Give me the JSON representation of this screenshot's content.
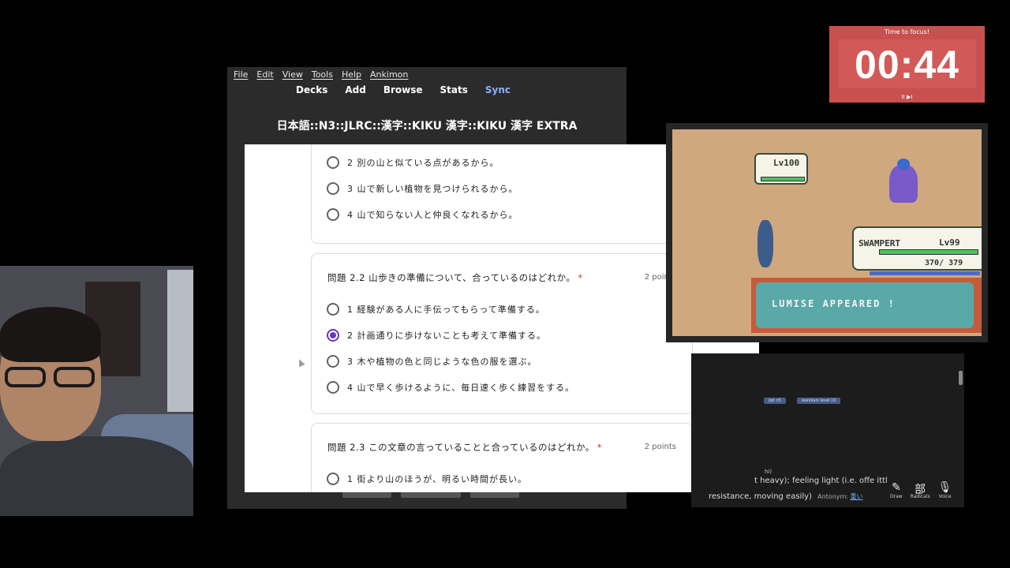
{
  "anki": {
    "menu": [
      "File",
      "Edit",
      "View",
      "Tools",
      "Help",
      "Ankimon"
    ],
    "toolbar": [
      "Decks",
      "Add",
      "Browse",
      "Stats",
      "Sync"
    ],
    "deck_title": "日本語::N3::JLRC::漢字::KIKU 漢字::KIKU 漢字 EXTRA"
  },
  "form": {
    "q1": {
      "options": [
        "2 別の山と似ている点があるから。",
        "3 山で新しい植物を見つけられるから。",
        "4 山で知らない人と仲良くなれるから。"
      ]
    },
    "q2": {
      "title": "問題 2.2 山歩きの準備について、合っているのはどれか。",
      "required": "*",
      "points": "2 points",
      "options": [
        "1 経験がある人に手伝ってもらって準備する。",
        "2 計画通りに歩けないことも考えて準備する。",
        "3 木や植物の色と同じような色の服を選ぶ。",
        "4 山で早く歩けるように、毎日速く歩く練習をする。"
      ],
      "selected_index": 1
    },
    "q3": {
      "title": "問題 2.3 この文章の言っていることと合っているのはどれか。",
      "required": "*",
      "points": "2 points",
      "options": [
        "1 街より山のほうが、明るい時間が長い。"
      ]
    },
    "scroll_top_icon": "chevron-up-icon"
  },
  "timer": {
    "label": "Time to focus!",
    "value": "00:44",
    "controls": "II ▶I"
  },
  "game": {
    "enemy_level": "Lv100",
    "player_name": "SWAMPERT",
    "player_level": "Lv99",
    "player_hp": "370/ 379",
    "message": "LUMISE APPEARED !"
  },
  "wk": {
    "tags": [
      "jlpt n5",
      "wanikani level 10"
    ],
    "hi": "hi)",
    "line1": "t heavy); feeling light (i.e. offe     ittl",
    "line2": "resistance, moving easily)",
    "antonym_label": "Antonym:",
    "antonym_value": "重い",
    "tools": [
      {
        "icon": "✎",
        "label": "Draw"
      },
      {
        "icon": "部",
        "label": "Radicals"
      },
      {
        "icon": "🎙",
        "label": "Voice"
      }
    ]
  }
}
